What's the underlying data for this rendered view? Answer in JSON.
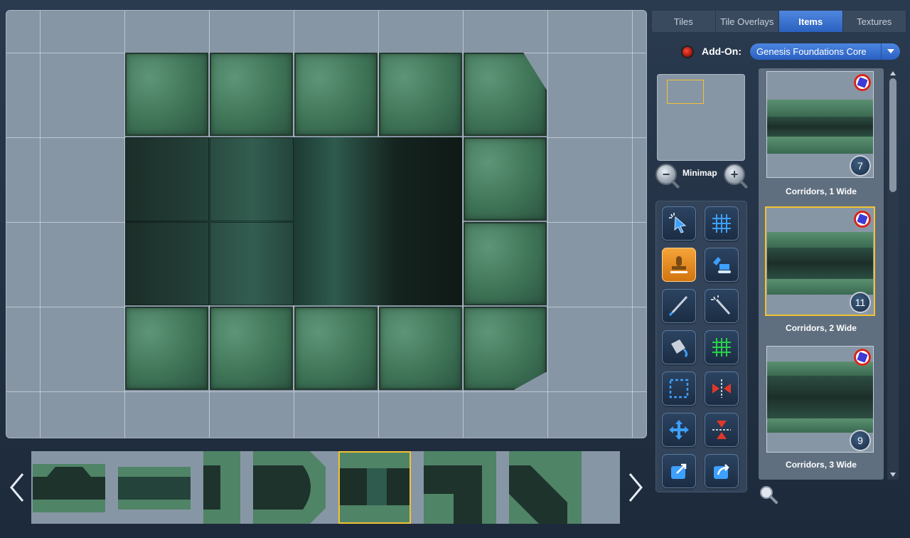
{
  "tabs": [
    "Tiles",
    "Tile Overlays",
    "Items",
    "Textures"
  ],
  "active_tab": "Items",
  "addon": {
    "label": "Add-On:",
    "selected": "Genesis Foundations Core"
  },
  "minimap": {
    "label": "Minimap"
  },
  "tools": {
    "icons": [
      "select-pointer-icon",
      "grid-icon",
      "stamp-icon",
      "excavator-icon",
      "brush-icon",
      "magic-wand-icon",
      "paint-bucket-icon",
      "grid-wall-icon",
      "selection-rect-icon",
      "flip-horizontal-icon",
      "move-icon",
      "flip-rotate-icon",
      "export-icon",
      "share-icon"
    ],
    "selected": "stamp-icon"
  },
  "items": [
    {
      "label": "Corridors, 1 Wide",
      "count": "7"
    },
    {
      "label": "Corridors, 2 Wide",
      "count": "11"
    },
    {
      "label": "Corridors, 3 Wide",
      "count": "9"
    }
  ],
  "selected_item": "Corridors, 2 Wide",
  "filmstrip": {
    "count": 7,
    "selected_index": 4
  },
  "colors": {
    "accent": "#2f6fd4",
    "selection": "#f2c232",
    "record": "#e0261a"
  }
}
